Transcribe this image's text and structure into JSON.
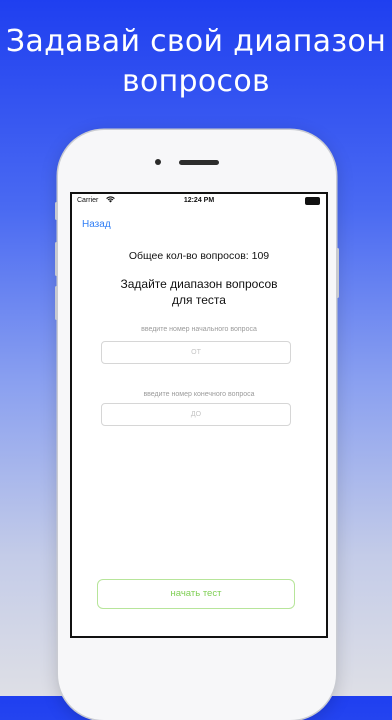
{
  "headline": {
    "line1": "Задавай свой диапазон",
    "line2": "вопросов"
  },
  "status_bar": {
    "carrier": "Carrier",
    "wifi_icon": "wifi-icon",
    "time": "12:24 PM",
    "battery_icon": "battery-icon"
  },
  "nav": {
    "back_label": "Назад"
  },
  "main": {
    "total_questions": "Общее кол-во вопросов: 109",
    "prompt": "Задайте диапазон вопросов\nдля теста",
    "start_hint": "введите номер начального вопроса",
    "start_placeholder": "ОТ",
    "end_hint": "введите номер конечного вопроса",
    "end_placeholder": "ДО",
    "start_button": "начать тест"
  },
  "colors": {
    "background_top": "#1f3ff0",
    "background_bottom": "#dedfe6",
    "link": "#2f7ef5",
    "start_button": "#7fcf54"
  }
}
